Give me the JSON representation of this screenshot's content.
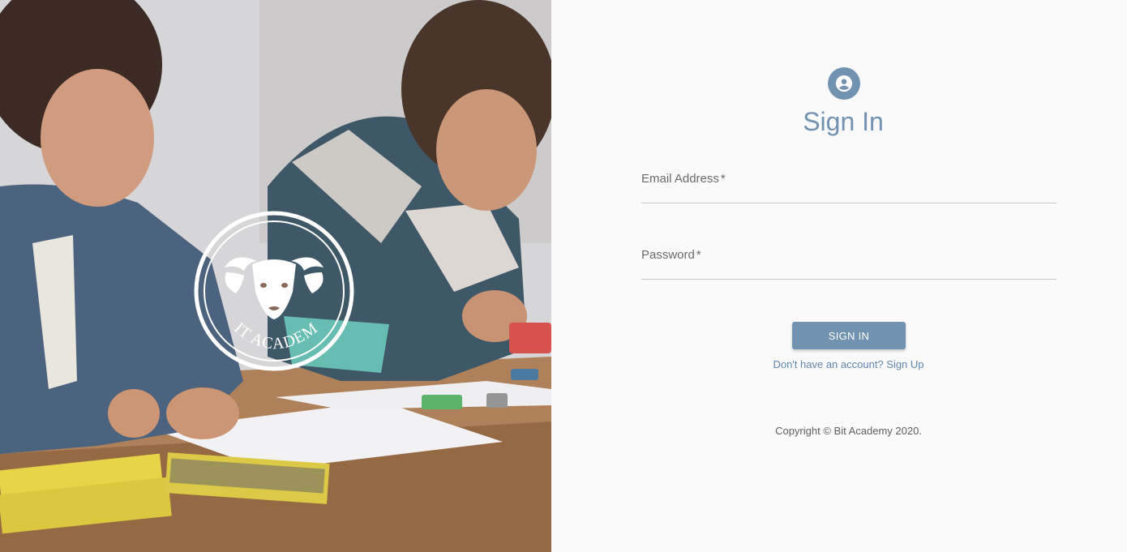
{
  "hero": {
    "logo_text": "BIT ACADEMY",
    "image_icon": "children-drawing-photo"
  },
  "signin": {
    "avatar_icon": "account-circle-icon",
    "title": "Sign In",
    "email": {
      "label": "Email Address",
      "required_mark": "*",
      "value": "",
      "placeholder": ""
    },
    "password": {
      "label": "Password",
      "required_mark": "*",
      "value": "",
      "placeholder": ""
    },
    "button_label": "SIGN IN",
    "signup_link": "Don't have an account? Sign Up",
    "copyright": "Copyright © Bit Academy 2020."
  },
  "colors": {
    "accent": "#7292b1",
    "link": "#6287aa",
    "background": "#fafafa"
  }
}
